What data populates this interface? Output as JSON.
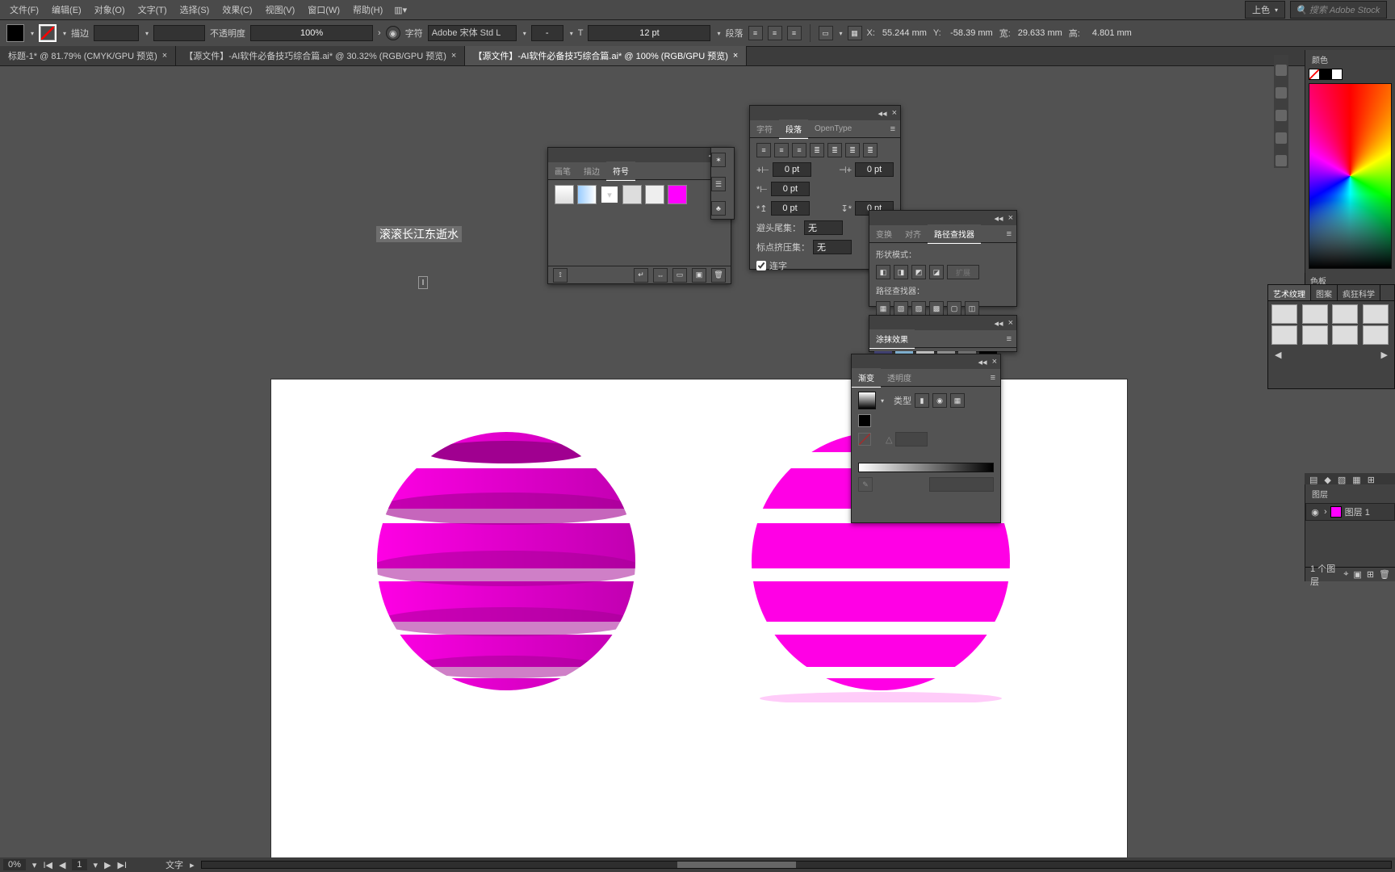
{
  "menu": {
    "items": [
      "文件(F)",
      "编辑(E)",
      "对象(O)",
      "文字(T)",
      "选择(S)",
      "效果(C)",
      "视图(V)",
      "窗口(W)",
      "帮助(H)"
    ]
  },
  "workspace": {
    "label": "上色"
  },
  "search": {
    "placeholder": "搜索 Adobe Stock"
  },
  "options": {
    "stroke_label": "描边",
    "opacity_label": "不透明度",
    "opacity_value": "100%",
    "char_label": "字符",
    "font_name": "Adobe 宋体 Std L",
    "font_style": "-",
    "font_size": "12 pt",
    "para_label": "段落",
    "x_label": "X:",
    "x_value": "55.244 mm",
    "y_label": "Y:",
    "y_value": "-58.39 mm",
    "w_label": "宽:",
    "w_value": "29.633 mm",
    "h_label": "高:",
    "h_value": "4.801 mm"
  },
  "tabs": [
    {
      "label": "标题-1* @ 81.79% (CMYK/GPU 预览)"
    },
    {
      "label": "【源文件】-AI软件必备技巧综合篇.ai* @ 30.32% (RGB/GPU 预览)"
    },
    {
      "label": "【源文件】-AI软件必备技巧综合篇.ai* @ 100% (RGB/GPU 预览)"
    }
  ],
  "canvas": {
    "selected_text": "滚滚长江东逝水"
  },
  "symbols_panel": {
    "tabs": [
      "画笔",
      "描边",
      "符号"
    ],
    "footer_icons": [
      "fx",
      "break",
      "place",
      "copy",
      "link",
      "trash"
    ]
  },
  "paragraph_panel": {
    "tabs": [
      "字符",
      "段落",
      "OpenType"
    ],
    "indent_left": "0 pt",
    "indent_right": "0 pt",
    "first_line": "0 pt",
    "space_before": "0 pt",
    "space_after": "0 pt",
    "hyphen_head_label": "避头尾集：",
    "hyphen_head_value": "无",
    "punct_label": "标点挤压集：",
    "punct_value": "无",
    "hyphen_checkbox_label": "连字"
  },
  "align_panel": {
    "tabs": [
      "变换",
      "对齐",
      "路径查找器"
    ],
    "shape_mode_label": "形状模式：",
    "expand_btn": "扩展",
    "pathfinder_label": "路径查找器："
  },
  "smudge_panel": {
    "title": "涂抹效果"
  },
  "gradient_panel": {
    "tabs": [
      "渐变",
      "透明度"
    ],
    "type_label": "类型"
  },
  "art_panel": {
    "tabs": [
      "艺术纹理",
      "图案",
      "疯狂科学"
    ]
  },
  "color_panel": {
    "title": "颜色"
  },
  "swatch_panel": {
    "title": "色板"
  },
  "layers": {
    "title": "图层",
    "layer1": "图层 1",
    "footer": "1 个图层"
  },
  "status": {
    "zoom": "0%",
    "artboard_num": "1",
    "tool": "文字"
  }
}
